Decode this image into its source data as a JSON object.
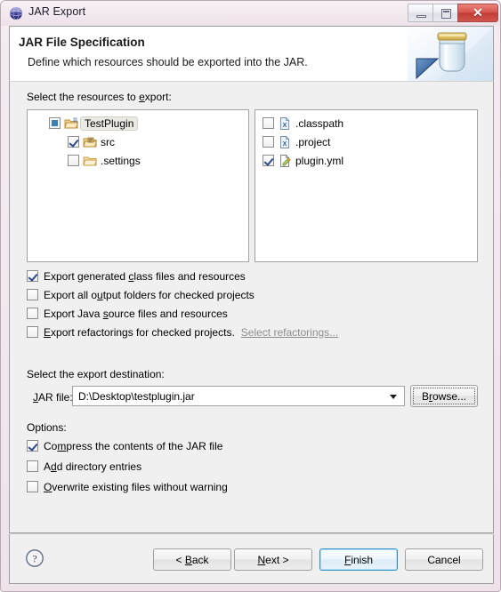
{
  "window": {
    "title": "JAR Export",
    "icon": "eclipse-globe-icon",
    "controls": {
      "minimize": "minimize-icon",
      "maximize": "maximize-icon",
      "close": "✕"
    }
  },
  "header": {
    "title": "JAR File Specification",
    "subtitle": "Define which resources should be exported into the JAR.",
    "art": "jar-illustration"
  },
  "resources": {
    "label": "Select the resources to export:",
    "label_mnemonic": "e",
    "tree": [
      {
        "name": "TestPlugin",
        "state": "grayed",
        "icon": "project-folder-icon",
        "indent": 0,
        "selected": true
      },
      {
        "name": "src",
        "state": "checked",
        "icon": "source-folder-icon",
        "indent": 1,
        "selected": false
      },
      {
        "name": ".settings",
        "state": "unchecked",
        "icon": "folder-icon",
        "indent": 1,
        "selected": false
      }
    ],
    "files": [
      {
        "name": ".classpath",
        "state": "unchecked",
        "icon": "xml-file-icon"
      },
      {
        "name": ".project",
        "state": "unchecked",
        "icon": "xml-file-icon"
      },
      {
        "name": "plugin.yml",
        "state": "checked",
        "icon": "yaml-file-icon"
      }
    ]
  },
  "export_options": [
    {
      "pre": "Export generated ",
      "mn": "c",
      "post": "lass files and resources",
      "checked": true
    },
    {
      "pre": "Export all o",
      "mn": "u",
      "post": "tput folders for checked projects",
      "checked": false
    },
    {
      "pre": "Export Java ",
      "mn": "s",
      "post": "ource files and resources",
      "checked": false
    },
    {
      "pre": "",
      "mn": "E",
      "post": "xport refactorings for checked projects.",
      "checked": false,
      "link": "Select refactorings..."
    }
  ],
  "destination": {
    "label": "Select the export destination:",
    "jar_file_label_pre": "",
    "jar_file_label_mn": "J",
    "jar_file_label_post": "AR file:",
    "jar_file_value": "D:\\Desktop\\testplugin.jar",
    "browse_pre": "B",
    "browse_mn": "r",
    "browse_post": "owse..."
  },
  "options": {
    "label": "Options:",
    "items": [
      {
        "pre": "Co",
        "mn": "m",
        "post": "press the contents of the JAR file",
        "checked": true
      },
      {
        "pre": "A",
        "mn": "d",
        "post": "d directory entries",
        "checked": false
      },
      {
        "pre": "",
        "mn": "O",
        "post": "verwrite existing files without warning",
        "checked": false
      }
    ]
  },
  "footer": {
    "help": "?",
    "buttons": [
      {
        "pre": "< ",
        "mn": "B",
        "post": "ack",
        "default": false
      },
      {
        "pre": "",
        "mn": "N",
        "post": "ext >",
        "default": false
      },
      {
        "pre": "",
        "mn": "F",
        "post": "inish",
        "default": true
      },
      {
        "pre": "Cancel",
        "mn": "",
        "post": "",
        "default": false
      }
    ]
  },
  "colors": {
    "accent": "#2e8fc4",
    "close_red": "#c03d36",
    "link_disabled": "#8d8d8d"
  }
}
